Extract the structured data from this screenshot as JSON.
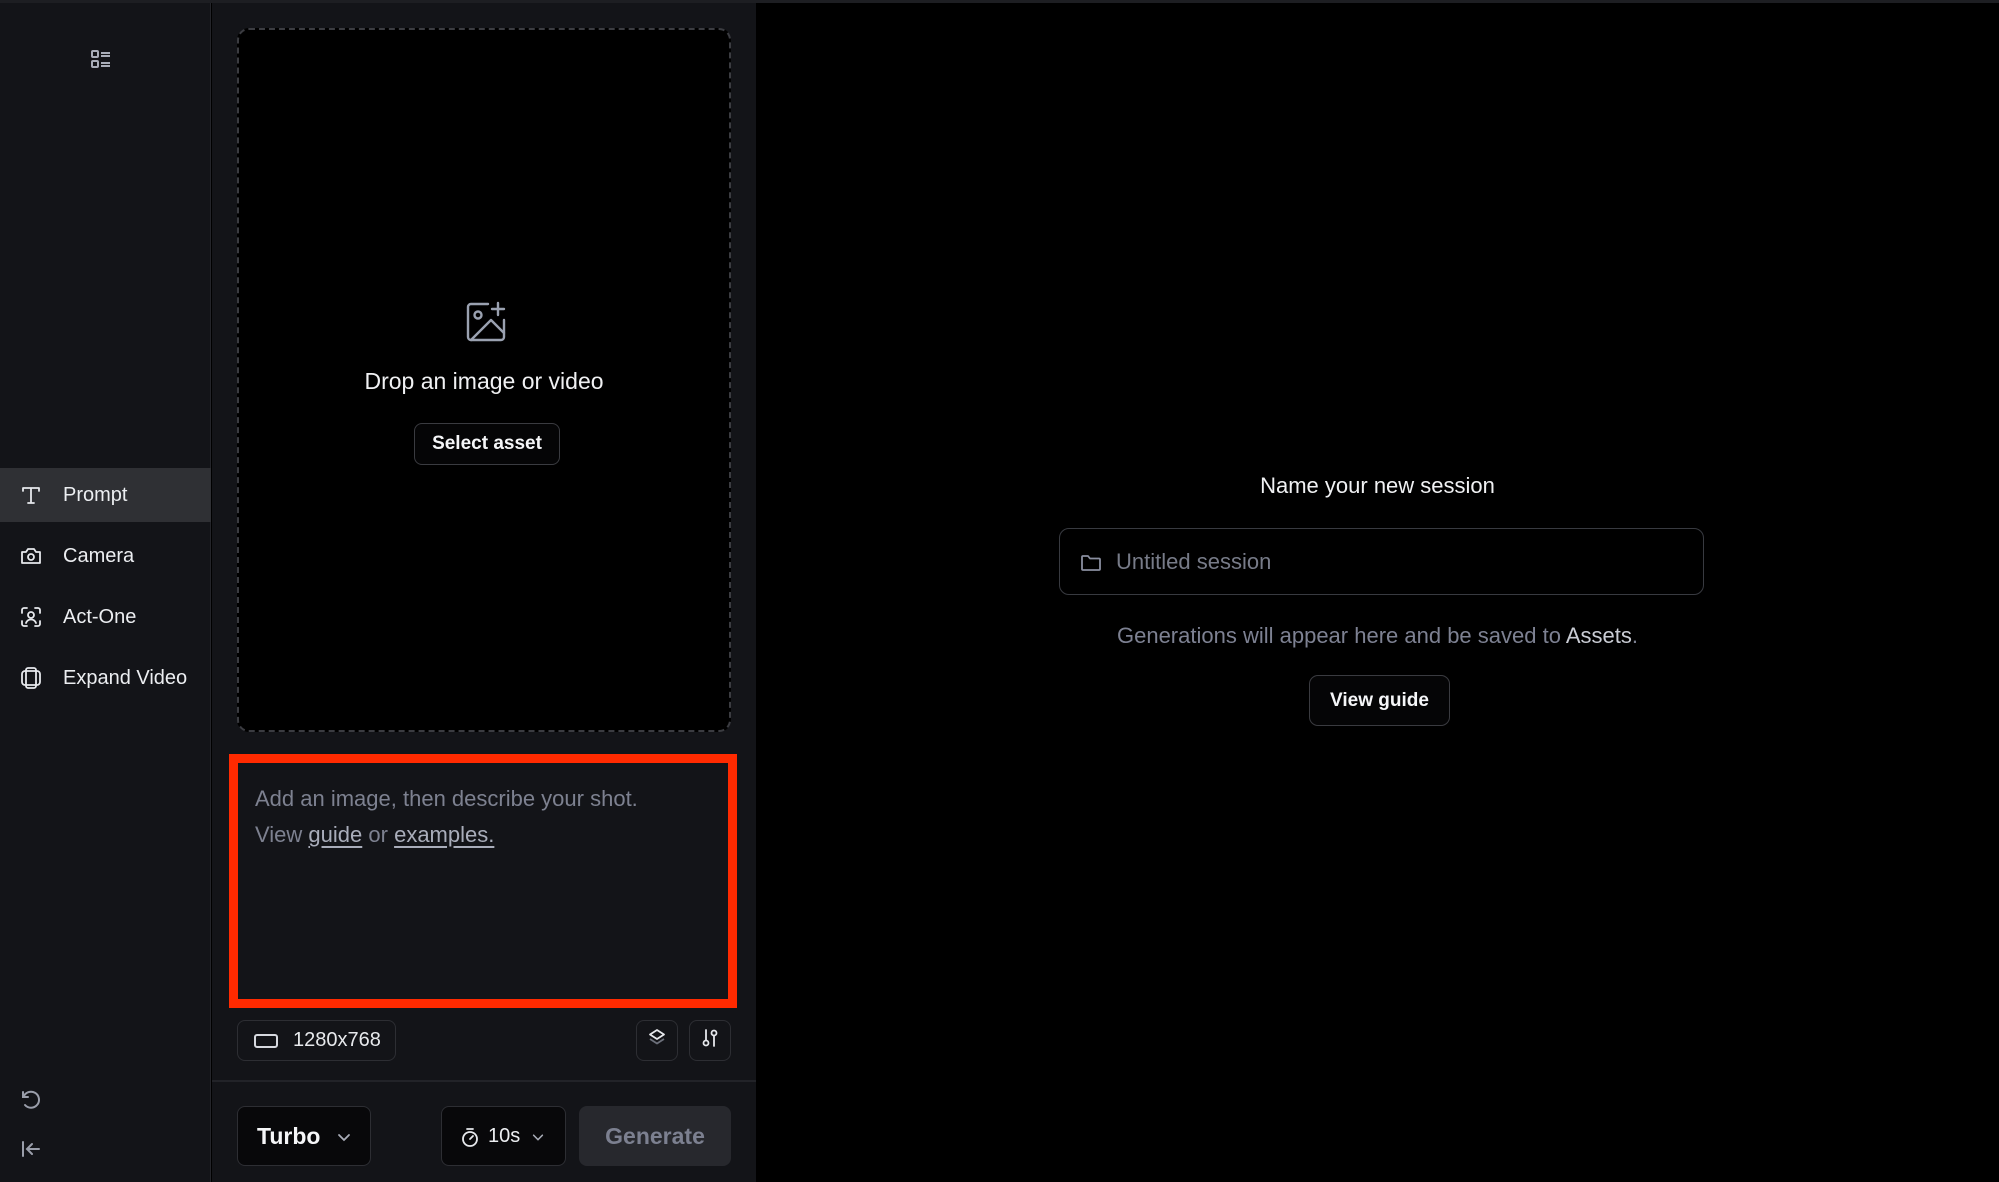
{
  "sidebar": {
    "top_icon": "layout-list-icon",
    "items": [
      {
        "label": "Prompt",
        "icon": "text-icon",
        "active": true
      },
      {
        "label": "Camera",
        "icon": "camera-icon",
        "active": false
      },
      {
        "label": "Act-One",
        "icon": "face-scan-icon",
        "active": false
      },
      {
        "label": "Expand Video",
        "icon": "expand-frame-icon",
        "active": false
      }
    ],
    "bottom_icons": [
      "undo-icon",
      "collapse-sidebar-icon"
    ]
  },
  "dropzone": {
    "icon": "image-add-icon",
    "text": "Drop an image or video",
    "button_label": "Select asset"
  },
  "prompt": {
    "placeholder_line1": "Add an image, then describe your shot.",
    "view_text": "View",
    "guide_link": "guide",
    "or_text": "or",
    "examples_link": "examples.",
    "highlight_color": "#ff2a00"
  },
  "toolbar": {
    "resolution": "1280x768",
    "resolution_icon": "aspect-ratio-icon",
    "layers_icon": "layers-icon",
    "settings_icon": "sliders-icon"
  },
  "footer": {
    "model": "Turbo",
    "duration": "10s",
    "generate_label": "Generate"
  },
  "session": {
    "title": "Name your new session",
    "placeholder": "Untitled session",
    "value": "",
    "note_prefix": "Generations will appear here and be saved to",
    "note_link": "Assets",
    "note_suffix": ".",
    "guide_button": "View guide"
  }
}
